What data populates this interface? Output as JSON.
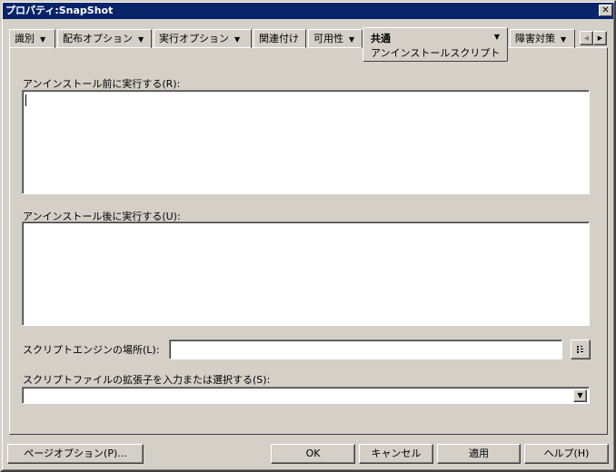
{
  "window": {
    "title": "プロパティ:SnapShot",
    "close": "✕"
  },
  "tabs": [
    {
      "label": "識別",
      "dropdown": true
    },
    {
      "label": "配布オプション",
      "dropdown": true
    },
    {
      "label": "実行オプション",
      "dropdown": true
    },
    {
      "label": "関連付け",
      "dropdown": false
    },
    {
      "label": "可用性",
      "dropdown": true
    },
    {
      "label": "共通",
      "dropdown": true,
      "active": true,
      "subtab": "アンインストールスクリプト"
    },
    {
      "label": "障害対策",
      "dropdown": true
    }
  ],
  "tab_scroll": {
    "left": "◀",
    "right": "▶"
  },
  "form": {
    "pre_label": "アンインストール前に実行する(R):",
    "pre_value": "",
    "post_label": "アンインストール後に実行する(U):",
    "post_value": "",
    "engine_label": "スクリプトエンジンの場所(L):",
    "engine_value": "",
    "ext_label": "スクリプトファイルの拡張子を入力または選択する(S):",
    "ext_value": ""
  },
  "buttons": {
    "page_options": "ページオプション(P)...",
    "ok": "OK",
    "cancel": "キャンセル",
    "apply": "適用",
    "help": "ヘルプ(H)"
  },
  "arrow": "▼"
}
